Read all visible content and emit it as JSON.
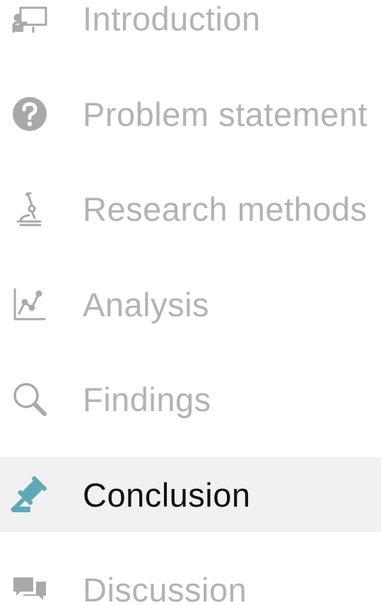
{
  "nav": {
    "items": [
      {
        "label": "Introduction",
        "icon": "presentation-icon",
        "active": false
      },
      {
        "label": "Problem statement",
        "icon": "question-circle-icon",
        "active": false
      },
      {
        "label": "Research methods",
        "icon": "microscope-icon",
        "active": false
      },
      {
        "label": "Analysis",
        "icon": "line-chart-icon",
        "active": false
      },
      {
        "label": "Findings",
        "icon": "search-icon",
        "active": false
      },
      {
        "label": "Conclusion",
        "icon": "gavel-icon",
        "active": true
      },
      {
        "label": "Discussion",
        "icon": "comments-icon",
        "active": false
      }
    ]
  },
  "colors": {
    "inactive_text": "#b3b3b3",
    "inactive_icon": "#a9a9a9",
    "active_text": "#111111",
    "active_icon": "#5fa8b8",
    "active_background": "#f1f1f1"
  }
}
